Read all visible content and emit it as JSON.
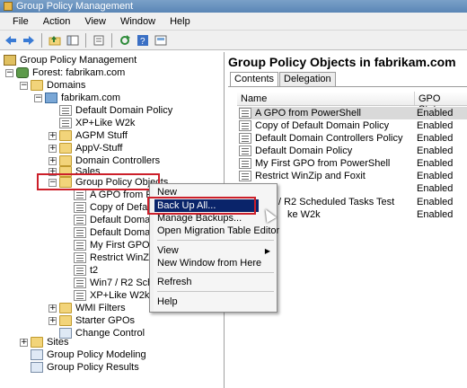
{
  "window": {
    "title": "Group Policy Management"
  },
  "menu": [
    "File",
    "Action",
    "View",
    "Window",
    "Help"
  ],
  "toolbar": {
    "icons": [
      "back-icon",
      "forward-icon",
      "up-folder-icon",
      "show-hide-tree-icon",
      "properties-icon",
      "refresh-icon",
      "help-icon",
      "console-icon"
    ]
  },
  "tree": {
    "root": "Group Policy Management",
    "forest": "Forest: fabrikam.com",
    "domains": "Domains",
    "domain": "fabrikam.com",
    "items": [
      "Default Domain Policy",
      "XP+Like W2k",
      "AGPM Stuff",
      "AppV-Stuff",
      "Domain Controllers",
      "Sales",
      "Group Policy Objects",
      "A GPO from P",
      "Copy of Defa",
      "Default Domai",
      "Default Domai",
      "My First GPO f",
      "Restrict WinZi",
      "t2",
      "Win7 / R2 Sch",
      "XP+Like W2k",
      "WMI Filters",
      "Starter GPOs",
      "Change Control",
      "Sites",
      "Group Policy Modeling",
      "Group Policy Results"
    ]
  },
  "right": {
    "title": "Group Policy Objects in fabrikam.com",
    "tabs": [
      "Contents",
      "Delegation"
    ],
    "columns": [
      "Name",
      "GPO Status"
    ],
    "rows": [
      {
        "name": "A GPO from PowerShell",
        "status": "Enabled"
      },
      {
        "name": "Copy of Default Domain Policy",
        "status": "Enabled"
      },
      {
        "name": "Default Domain Controllers Policy",
        "status": "Enabled"
      },
      {
        "name": "Default Domain Policy",
        "status": "Enabled"
      },
      {
        "name": "My First GPO from PowerShell",
        "status": "Enabled"
      },
      {
        "name": "Restrict WinZip and Foxit",
        "status": "Enabled"
      },
      {
        "name": "",
        "status": "Enabled"
      },
      {
        "name": "/ R2 Scheduled Tasks Test",
        "status": "Enabled"
      },
      {
        "name": "ke W2k",
        "status": "Enabled"
      }
    ]
  },
  "context_menu": {
    "items": [
      "New",
      "Back Up All...",
      "Manage Backups...",
      "Open Migration Table Editor",
      "View",
      "New Window from Here",
      "Refresh",
      "Help"
    ]
  }
}
